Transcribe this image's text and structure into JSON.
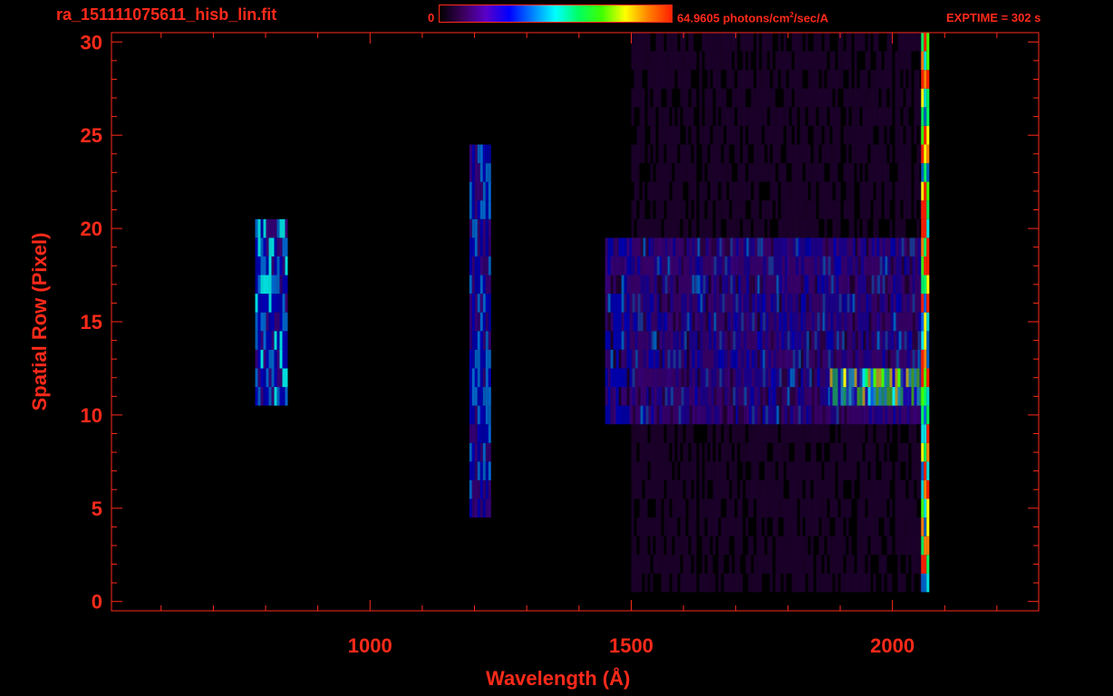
{
  "header": {
    "file_title": "ra_151111075611_hisb_lin.fit",
    "colorbar_min": "0",
    "colorbar_max_value": "64.9605 photons/cm",
    "colorbar_max_sup": "2",
    "colorbar_max_unit": "/sec/A",
    "exptime": "EXPTIME = 302 s",
    "colorbar_stops": [
      "#000000",
      "#3a005a",
      "#5a00c8",
      "#0000ff",
      "#0080ff",
      "#00ffff",
      "#00ff60",
      "#40ff00",
      "#ffff00",
      "#ff8000",
      "#ff2000"
    ]
  },
  "chart_data": {
    "type": "heatmap",
    "title": "ra_151111075611_hisb_lin.fit",
    "xlabel": "Wavelength (Å)",
    "ylabel": "Spatial Row (Pixel)",
    "xlim": [
      505,
      2280
    ],
    "ylim": [
      -0.5,
      30.5
    ],
    "x_ticks": [
      1000,
      1500,
      2000
    ],
    "y_ticks": [
      0,
      5,
      10,
      15,
      20,
      25,
      30
    ],
    "x_minor_step": 100,
    "y_minor_step": 1,
    "color_range": [
      0,
      64.9605
    ],
    "color_unit": "photons/cm^2/sec/A",
    "exposure_time_s": 302,
    "features": [
      {
        "name": "emission-800",
        "x_range": [
          780,
          840
        ],
        "y_range": [
          11,
          20
        ],
        "level": 0.35
      },
      {
        "name": "lyman-alpha-1216",
        "x_range": [
          1190,
          1230
        ],
        "y_range": [
          5,
          24
        ],
        "level": 0.3
      },
      {
        "name": "continuum-band",
        "x_range": [
          1450,
          2060
        ],
        "y_range": [
          10,
          19
        ],
        "level": 0.25
      },
      {
        "name": "bright-row-11",
        "x_range": [
          1880,
          2060
        ],
        "y_range": [
          11,
          12
        ],
        "level": 0.55
      },
      {
        "name": "faint-halo",
        "x_range": [
          1500,
          2060
        ],
        "y_range": [
          1,
          30
        ],
        "level": 0.08
      },
      {
        "name": "edge-column-2065",
        "x_range": [
          2055,
          2070
        ],
        "y_range": [
          1,
          30
        ],
        "level": 0.75
      }
    ]
  },
  "axes": {
    "xlabel": "Wavelength (Å)",
    "ylabel": "Spatial Row (Pixel)"
  }
}
